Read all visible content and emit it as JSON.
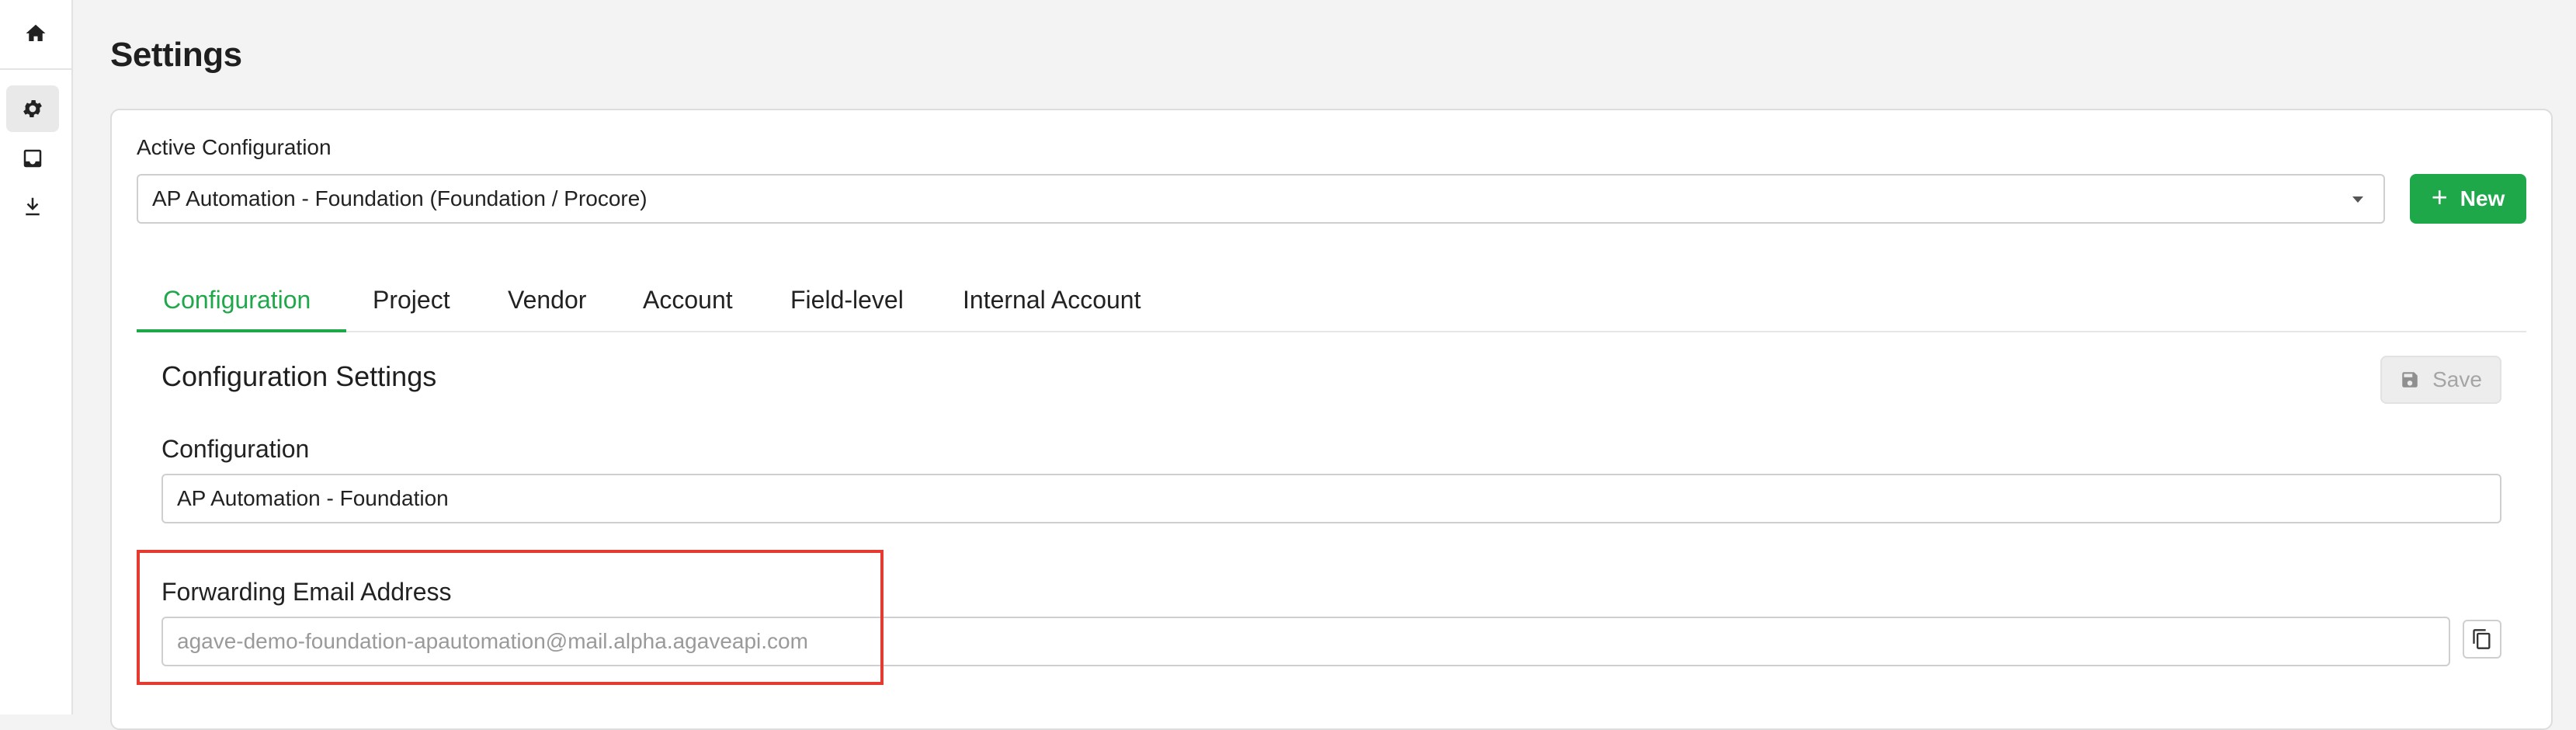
{
  "sidebar": {
    "items": [
      {
        "icon": "home-icon"
      },
      {
        "icon": "gear-icon",
        "active": true
      },
      {
        "icon": "inbox-icon"
      },
      {
        "icon": "download-icon"
      }
    ]
  },
  "page": {
    "title": "Settings"
  },
  "active_configuration": {
    "label": "Active Configuration",
    "selected": "AP Automation - Foundation (Foundation / Procore)",
    "new_button": "New"
  },
  "tabs": [
    {
      "label": "Configuration",
      "active": true
    },
    {
      "label": "Project"
    },
    {
      "label": "Vendor"
    },
    {
      "label": "Account"
    },
    {
      "label": "Field-level"
    },
    {
      "label": "Internal Account"
    }
  ],
  "section": {
    "title": "Configuration Settings",
    "save_label": "Save",
    "configuration_label": "Configuration",
    "configuration_value": "AP Automation - Foundation",
    "forwarding_label": "Forwarding Email Address",
    "forwarding_value": "agave-demo-foundation-apautomation@mail.alpha.agaveapi.com"
  },
  "colors": {
    "accent": "#1fa84a",
    "highlight": "#e53a2f"
  }
}
